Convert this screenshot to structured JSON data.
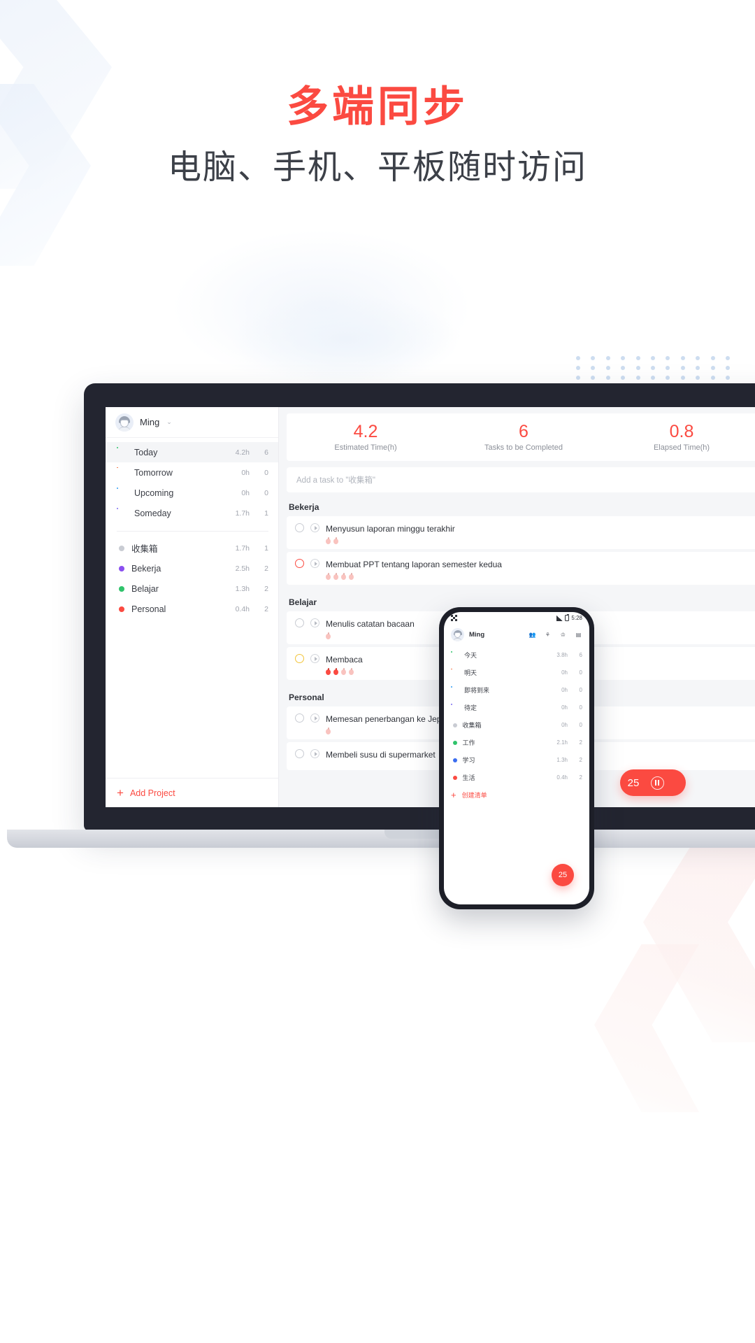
{
  "headline": {
    "title": "多端同步",
    "subtitle": "电脑、手机、平板随时访问",
    "title_color": "#fb4a41",
    "subtitle_color": "#3c4048"
  },
  "desktop": {
    "profile": {
      "name": "Ming",
      "caret": "⌄",
      "avatar_icon": "user-avatar"
    },
    "nav": [
      {
        "label": "Today",
        "icon": "sun-icon",
        "time": "4.2h",
        "count": "6",
        "active": true
      },
      {
        "label": "Tomorrow",
        "icon": "sunset-icon",
        "time": "0h",
        "count": "0",
        "active": false
      },
      {
        "label": "Upcoming",
        "icon": "calendar-check-icon",
        "time": "0h",
        "count": "0",
        "active": false
      },
      {
        "label": "Someday",
        "icon": "calendar-icon",
        "time": "1.7h",
        "count": "1",
        "active": false
      }
    ],
    "projects": [
      {
        "label": "收集箱",
        "color": "#c9ccd3",
        "time": "1.7h",
        "count": "1"
      },
      {
        "label": "Bekerja",
        "color": "#8a4ff0",
        "time": "2.5h",
        "count": "2"
      },
      {
        "label": "Belajar",
        "color": "#2fc36b",
        "time": "1.3h",
        "count": "2"
      },
      {
        "label": "Personal",
        "color": "#fb4a41",
        "time": "0.4h",
        "count": "2"
      }
    ],
    "add_project": {
      "label": "Add Project",
      "plus": "+"
    },
    "stats": [
      {
        "value": "4.2",
        "label": "Estimated Time(h)"
      },
      {
        "value": "6",
        "label": "Tasks to be Completed"
      },
      {
        "value": "0.8",
        "label": "Elapsed Time(h)"
      }
    ],
    "add_task_placeholder": "Add a task to \"收集箱\"",
    "groups": [
      {
        "title": "Bekerja",
        "tasks": [
          {
            "title": "Menyusun laporan minggu terakhir",
            "check": "grey",
            "pomos": [
              0,
              0
            ]
          },
          {
            "title": "Membuat PPT tentang laporan semester kedua",
            "check": "red",
            "pomos": [
              0,
              0,
              0,
              0
            ]
          }
        ]
      },
      {
        "title": "Belajar",
        "tasks": [
          {
            "title": "Menulis catatan bacaan",
            "check": "grey",
            "pomos": [
              0
            ]
          },
          {
            "title": "Membaca",
            "check": "yellow",
            "pomos": [
              1,
              1,
              0,
              0
            ]
          }
        ]
      },
      {
        "title": "Personal",
        "tasks": [
          {
            "title": "Memesan penerbangan ke Jepang",
            "check": "grey",
            "pomos": [
              0
            ]
          },
          {
            "title": "Membeli susu di supermarket",
            "check": "grey",
            "pomos": []
          }
        ]
      }
    ],
    "timer": {
      "minutes": "25",
      "control_icon": "pause-icon"
    }
  },
  "phone": {
    "status": {
      "time": "5:28",
      "qr_icon": "qr-icon",
      "signal_icon": "signal-icon",
      "battery_icon": "battery-icon"
    },
    "header": {
      "name": "Ming",
      "tools": [
        "people-icon",
        "bird-icon",
        "trophy-icon",
        "stats-icon"
      ]
    },
    "nav": [
      {
        "label": "今天",
        "icon": "sun-icon",
        "time": "3.8h",
        "count": "6"
      },
      {
        "label": "明天",
        "icon": "sunset-icon",
        "time": "0h",
        "count": "0"
      },
      {
        "label": "即将到来",
        "icon": "calendar-check-icon",
        "time": "0h",
        "count": "0"
      },
      {
        "label": "待定",
        "icon": "calendar-icon",
        "time": "0h",
        "count": "0"
      }
    ],
    "projects": [
      {
        "label": "收集箱",
        "color": "#c9ccd3",
        "time": "0h",
        "count": "0"
      },
      {
        "label": "工作",
        "color": "#2fc36b",
        "time": "2.1h",
        "count": "2"
      },
      {
        "label": "学习",
        "color": "#3a6df0",
        "time": "1.3h",
        "count": "2"
      },
      {
        "label": "生活",
        "color": "#fb4a41",
        "time": "0.4h",
        "count": "2"
      }
    ],
    "add_list": {
      "label": "创建清单",
      "plus": "+"
    },
    "fab": {
      "minutes": "25"
    }
  }
}
